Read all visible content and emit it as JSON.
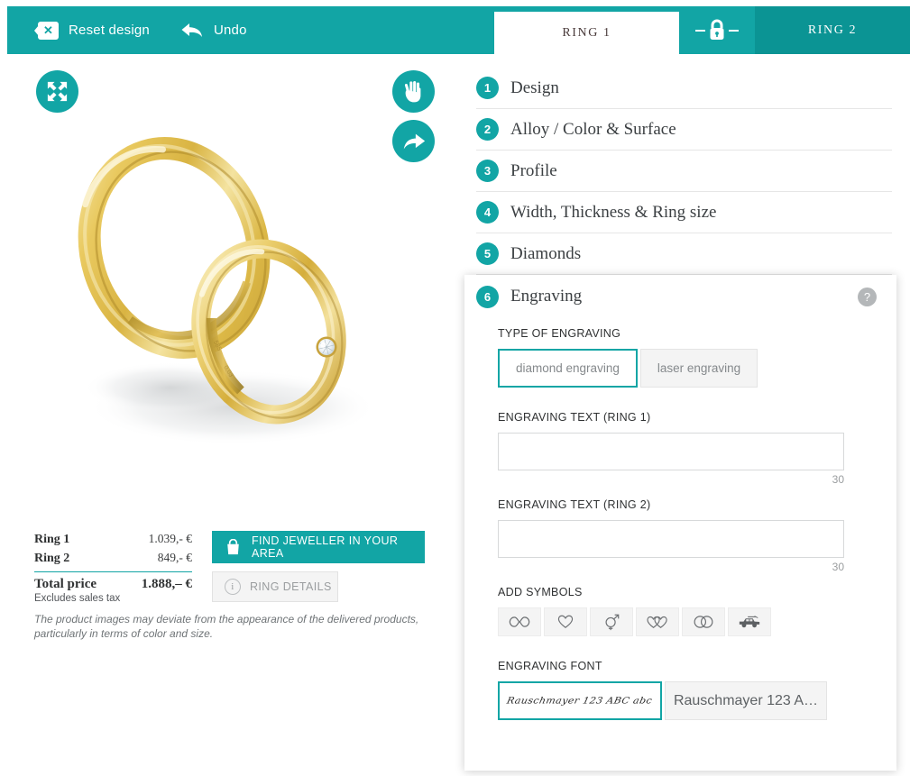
{
  "toolbar": {
    "reset_label": "Reset design",
    "reset_icon": "close-x-icon",
    "undo_label": "Undo",
    "undo_icon": "undo-arrow-icon"
  },
  "tabs": {
    "ring1_label": "RING 1",
    "ring2_label": "RING 2",
    "lock_icon": "lock-icon"
  },
  "viewer": {
    "fullscreen_icon": "fullscreen-expand-icon",
    "pan_icon": "hand-pan-icon",
    "rotate_icon": "rotate-arrow-icon",
    "product_alt": "two gold wedding rings with diamond"
  },
  "price": {
    "ring1_label": "Ring 1",
    "ring1_value": "1.039,- €",
    "ring2_label": "Ring 2",
    "ring2_value": "849,- €",
    "total_label": "Total price",
    "total_value": "1.888,– €",
    "tax_note": "Excludes sales tax",
    "disclaimer": "The product images may deviate from the appearance of the delivered products, particularly in terms of color and size."
  },
  "actions": {
    "find_jeweller_label": "FIND JEWELLER IN YOUR AREA",
    "find_jeweller_icon": "shopping-bag-icon",
    "ring_details_label": "RING DETAILS",
    "ring_details_icon": "info-icon"
  },
  "steps": [
    {
      "num": "1",
      "label": "Design"
    },
    {
      "num": "2",
      "label": "Alloy / Color & Surface"
    },
    {
      "num": "3",
      "label": "Profile"
    },
    {
      "num": "4",
      "label": "Width, Thickness & Ring size"
    },
    {
      "num": "5",
      "label": "Diamonds"
    }
  ],
  "engraving": {
    "step_num": "6",
    "title": "Engraving",
    "help_icon": "question-mark-icon",
    "help_label": "?",
    "type_label": "TYPE OF ENGRAVING",
    "type_options": [
      {
        "label": "diamond engraving",
        "selected": true
      },
      {
        "label": "laser engraving",
        "selected": false
      }
    ],
    "ring1_text_label": "ENGRAVING TEXT (RING 1)",
    "ring1_text_value": "",
    "ring1_text_placeholder": "",
    "ring1_counter": "30",
    "ring2_text_label": "ENGRAVING TEXT (RING 2)",
    "ring2_text_value": "",
    "ring2_text_placeholder": "",
    "ring2_counter": "30",
    "symbols_label": "ADD SYMBOLS",
    "symbols": [
      {
        "name": "infinity-icon"
      },
      {
        "name": "heart-icon"
      },
      {
        "name": "gender-symbols-icon"
      },
      {
        "name": "two-hearts-icon"
      },
      {
        "name": "two-rings-icon"
      },
      {
        "name": "car-icon"
      }
    ],
    "font_label": "ENGRAVING FONT",
    "font_options": [
      {
        "label": "Rauschmayer 123 ABC abc",
        "style": "script",
        "selected": true
      },
      {
        "label": "Rauschmayer 123 A…",
        "style": "sans",
        "selected": false
      }
    ]
  },
  "colors": {
    "teal": "#12a5a5",
    "teal_dark": "#0b9494",
    "gold": "#e8c55c"
  }
}
